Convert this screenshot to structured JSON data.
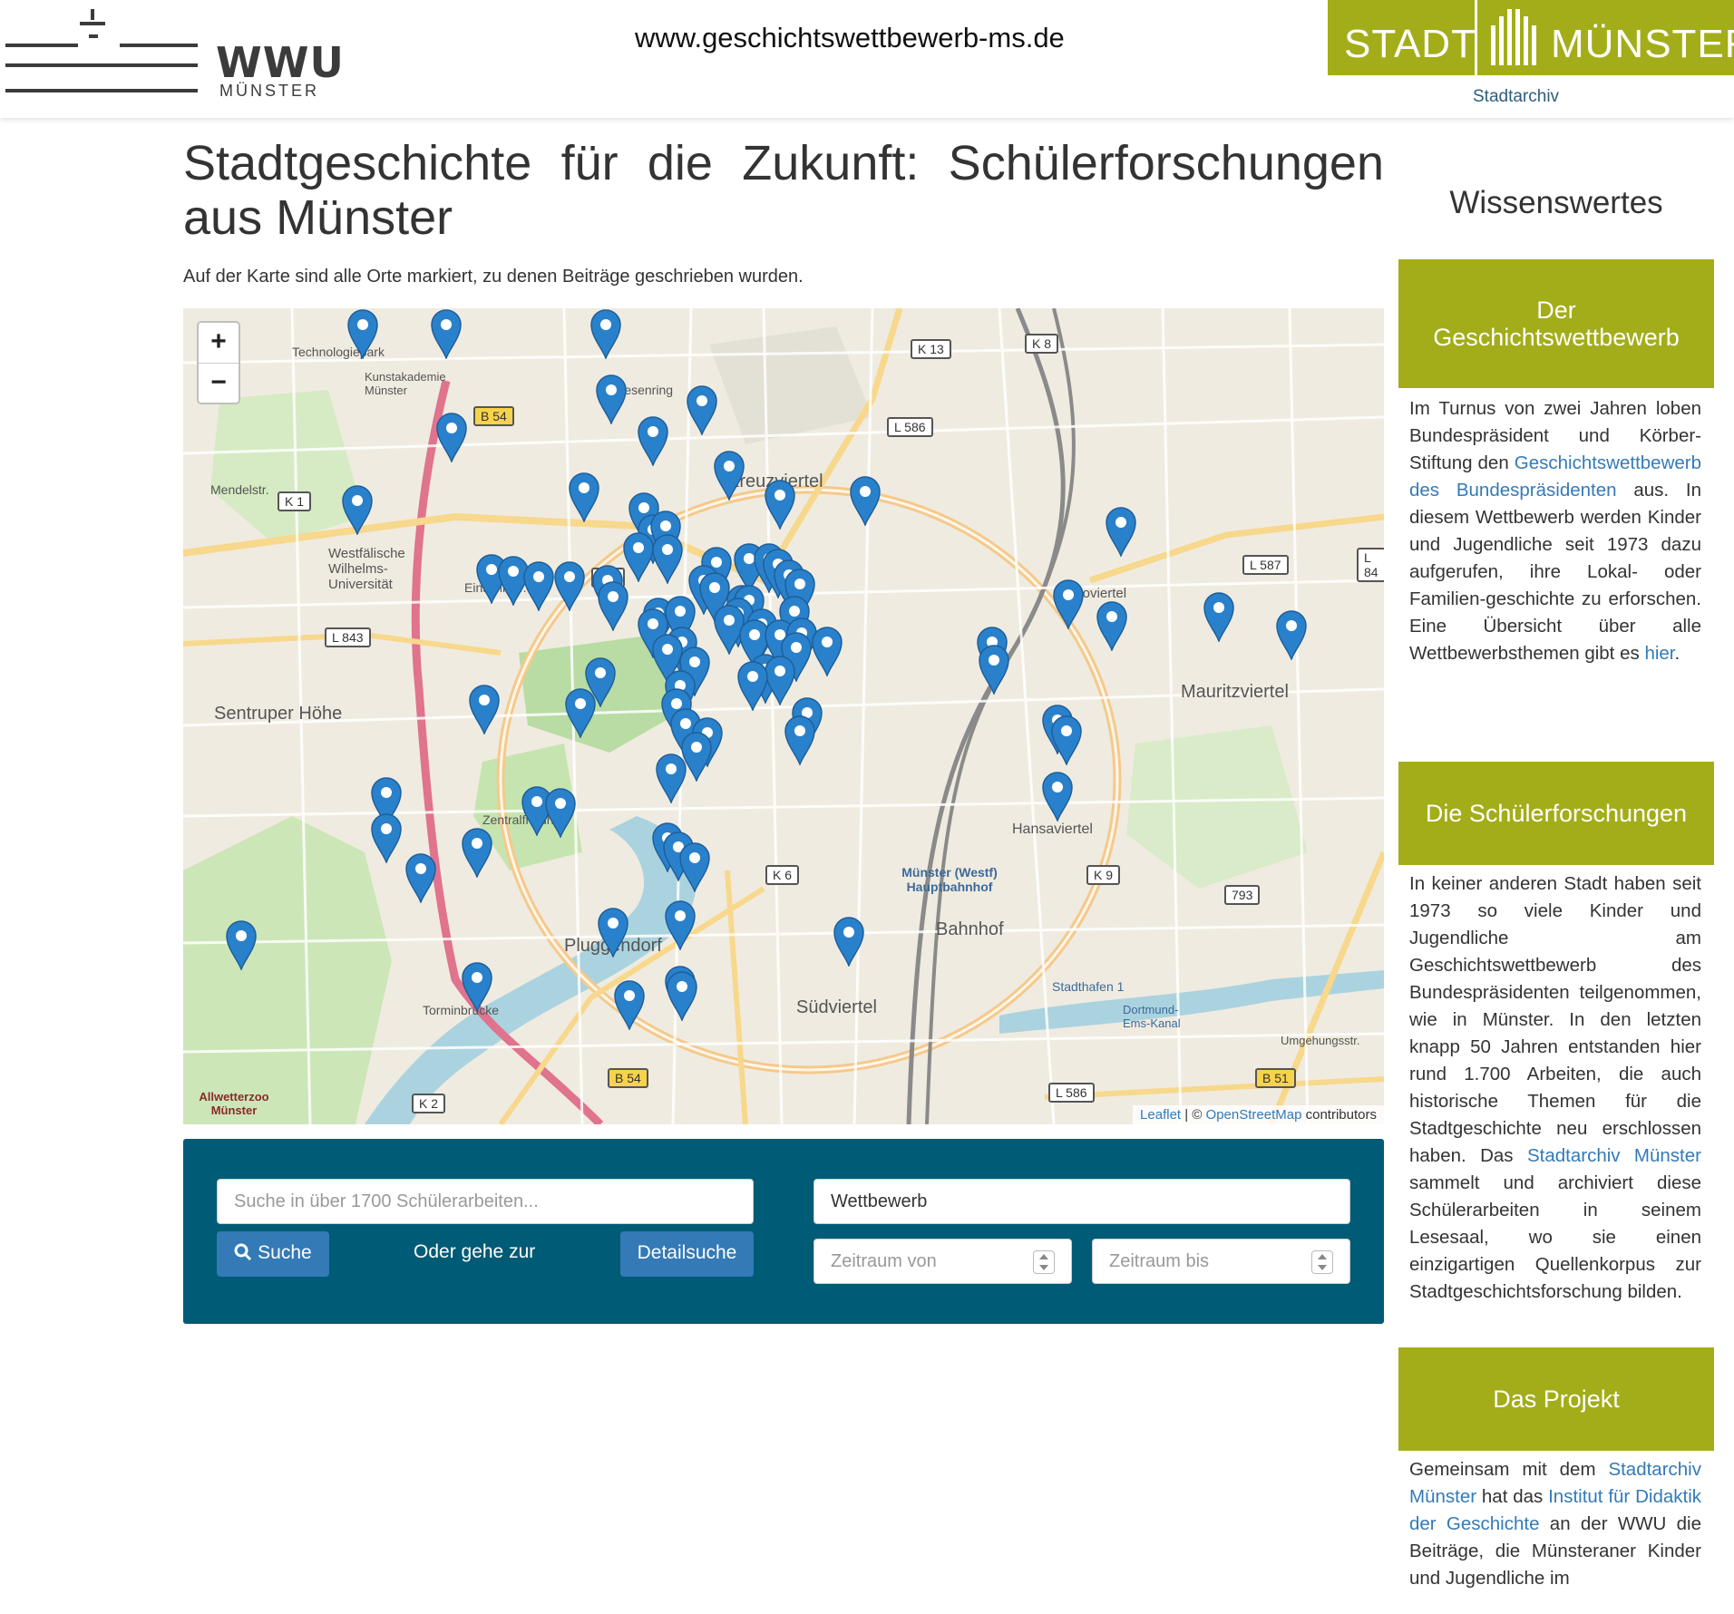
{
  "header": {
    "wwu_name": "WWU",
    "wwu_sub": "MÜNSTER",
    "url": "www.geschichtswettbewerb-ms.de",
    "stadt_word": "STADT",
    "muenster_word": "MÜNSTER",
    "stadtarchiv": "Stadtarchiv"
  },
  "main": {
    "title": "Stadtgeschichte für die Zukunft: Schülerforschungen aus Münster",
    "intro": "Auf der Karte sind alle Orte markiert, zu denen Beiträge geschrieben wurden."
  },
  "map": {
    "zoom_in": "+",
    "zoom_out": "−",
    "attribution_leaflet": "Leaflet",
    "attribution_sep": " | © ",
    "attribution_osm": "OpenStreetMap",
    "attribution_rest": " contributors",
    "labels": {
      "technologiepark": "Technologiepark",
      "kunstakademie": "Kunstakademie Münster",
      "friesenring": "Friesenring",
      "kreuzviertel": "Kreuzviertel",
      "mendelstr": "Mendelstr.",
      "westf_uni": "Westfälische Wilhelms-Universität",
      "einsteinstr": "Einsteinstr.",
      "sentruper": "Sentruper Höhe",
      "zentralfriedhof": "Zentralfriedhof",
      "pluggendorf": "Pluggendorf",
      "hansaviertel": "Hansaviertel",
      "hauptbahnhof": "Münster (Westf) Hauptbahnhof",
      "bahnhof": "Bahnhof",
      "suedviertel": "Südviertel",
      "erphoviertel": "Erphoviertel",
      "mauritzviertel": "Mauritzviertel",
      "stadthafen": "Stadthafen 1",
      "dortmund_ems": "Dortmund-Ems-Kanal",
      "torminbruecke": "Torminbrücke",
      "allwetterzoo": "Allwetterzoo Münster",
      "umgehungsstr": "Umgehungsstr."
    },
    "roads": [
      "K 13",
      "K 8",
      "B 54",
      "L 586",
      "K 1",
      "K 4",
      "L 843",
      "L 587",
      "K 6",
      "K 9",
      "793",
      "K 2",
      "B 54",
      "L 586",
      "B 51",
      "L 84"
    ]
  },
  "search": {
    "placeholder": "Suche in über 1700 Schülerarbeiten...",
    "button": "Suche",
    "oder": "Oder gehe zur",
    "detail_button": "Detailsuche",
    "wettbewerb": "Wettbewerb",
    "zeitraum_von": "Zeitraum von",
    "zeitraum_bis": "Zeitraum bis"
  },
  "sidebar": {
    "title": "Wissenswertes",
    "sections": [
      {
        "heading": "Der Geschichtswettbewerb",
        "p1": "Im Turnus von zwei Jahren loben Bundespräsident und Körber-Stiftung den ",
        "link1": "Geschichtswettbewerb des Bundespräsidenten",
        "p2": " aus. In diesem Wettbewerb werden Kinder und Jugendliche seit 1973 dazu aufgerufen, ihre Lokal- oder Familien-geschichte zu erforschen. Eine Übersicht über alle Wettbewerbsthemen gibt es ",
        "link2": "hier",
        "p3": "."
      },
      {
        "heading": "Die Schülerforschungen",
        "p1": "In keiner anderen Stadt haben seit 1973 so viele Kinder und Jugendliche am Geschichtswettbewerb des Bundespräsidenten teilgenommen, wie in Münster. In den letzten knapp 50 Jahren entstanden hier rund 1.700 Arbeiten, die auch historische Themen für die Stadtgeschichte neu erschlossen haben. Das ",
        "link1": "Stadtarchiv Münster",
        "p2": " sammelt und archiviert diese Schülerarbeiten in seinem Lesesaal, wo sie einen einzigartigen Quellenkorpus zur Stadtgeschichtsforschung bilden."
      },
      {
        "heading": "Das Projekt",
        "p1": "Gemeinsam mit dem ",
        "link1": "Stadtarchiv Münster",
        "p2": " hat das ",
        "link2": "Institut für Didaktik der Geschichte",
        "p3": " an der WWU die Beiträge, die Münsteraner Kinder und Jugendliche im"
      }
    ]
  },
  "colors": {
    "stadt_green": "#a3ad19",
    "panel_blue": "#005b76",
    "button_blue": "#337ab7",
    "marker_blue": "#2a81cb"
  }
}
